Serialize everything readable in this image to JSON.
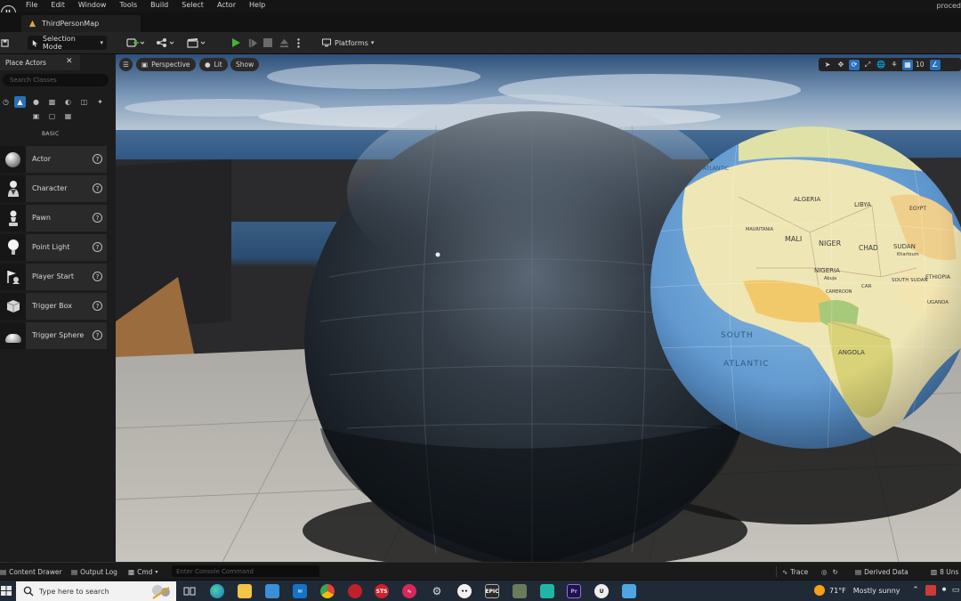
{
  "menu": {
    "items": [
      "File",
      "Edit",
      "Window",
      "Tools",
      "Build",
      "Select",
      "Actor",
      "Help"
    ],
    "project_name": "proced"
  },
  "tab": {
    "level_name": "ThirdPersonMap"
  },
  "toolbar": {
    "selection_mode": "Selection Mode",
    "platforms": "Platforms"
  },
  "place_actors": {
    "title": "Place Actors",
    "search_placeholder": "Search Classes",
    "category_label": "BASIC",
    "actors": [
      {
        "label": "Actor",
        "icon": "sphere-icon"
      },
      {
        "label": "Character",
        "icon": "character-icon"
      },
      {
        "label": "Pawn",
        "icon": "pawn-icon"
      },
      {
        "label": "Point Light",
        "icon": "point-light-icon"
      },
      {
        "label": "Player Start",
        "icon": "player-start-icon"
      },
      {
        "label": "Trigger Box",
        "icon": "trigger-box-icon"
      },
      {
        "label": "Trigger Sphere",
        "icon": "trigger-sphere-icon"
      }
    ]
  },
  "viewport": {
    "perspective": "Perspective",
    "lit": "Lit",
    "show": "Show",
    "grid_size": "10",
    "globe_labels": {
      "algeria": "ALGERIA",
      "libya": "LIBYA",
      "egypt": "EGYPT",
      "mali": "MALI",
      "niger": "NIGER",
      "chad": "CHAD",
      "sudan": "SUDAN",
      "nigeria": "NIGERIA",
      "ethiopia": "ETHIOPIA",
      "south": "SOUTH",
      "atlantic": "ATLANTIC",
      "angola": "ANGOLA",
      "south_sudan": "SOUTH SUDAN",
      "mauritania": "MAURITANIA",
      "abuja": "Abuja",
      "khartoum": "Khartoum",
      "uganda": "UGANDA",
      "car": "CAR",
      "cameroon": "CAMEROON",
      "atlantic_top": "ATLANTIC"
    }
  },
  "statusbar": {
    "content_drawer": "Content Drawer",
    "output_log": "Output Log",
    "cmd": "Cmd",
    "cmd_placeholder": "Enter Console Command",
    "trace": "Trace",
    "derived_data": "Derived Data",
    "unsaved": "8 Uns"
  },
  "taskbar": {
    "search_placeholder": "Type here to search",
    "temperature": "71°F",
    "weather": "Mostly sunny",
    "apps": [
      "task-view",
      "edge",
      "file-explorer",
      "store",
      "mail",
      "chrome",
      "app-red",
      "app-sts",
      "app-pulse",
      "settings",
      "app-dots",
      "epic-games",
      "app-tools",
      "app-teal",
      "premiere",
      "unreal",
      "app-blue"
    ],
    "colors": {
      "taskbar_bg": "#1f2a36",
      "accent_blue": "#2a6fb8",
      "play_green": "#45b332"
    }
  }
}
